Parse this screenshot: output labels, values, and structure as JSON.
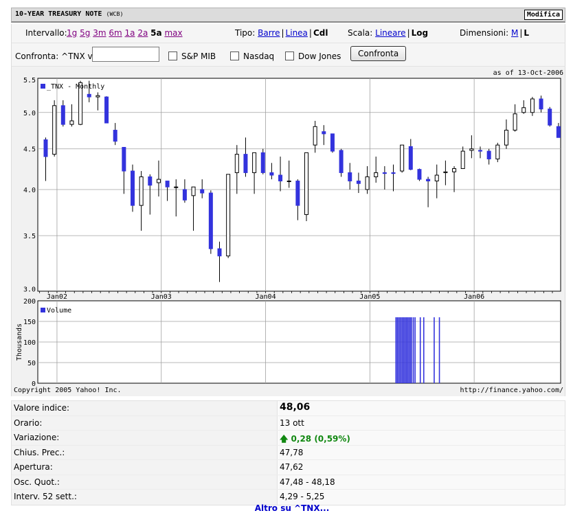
{
  "header": {
    "title": "10-YEAR TREASURY NOTE",
    "exchange": "(WCB)",
    "edit_label": "Modifica"
  },
  "range": {
    "label": "Intervallo:",
    "options": [
      "1g",
      "5g",
      "3m",
      "6m",
      "1a",
      "2a",
      "5a",
      "max"
    ],
    "selected": "5a"
  },
  "type": {
    "label": "Tipo:",
    "options": [
      "Barre",
      "Linea",
      "Cdl"
    ],
    "selected": "Cdl"
  },
  "scale": {
    "label": "Scala:",
    "options": [
      "Lineare",
      "Log"
    ],
    "selected": "Log"
  },
  "size": {
    "label": "Dimensioni:",
    "options": [
      "M",
      "L"
    ],
    "selected": "L"
  },
  "compare": {
    "label": "Confronta: ^TNX vs",
    "input_value": "",
    "checkboxes": [
      "S&P MIB",
      "Nasdaq",
      "Dow Jones"
    ],
    "button_label": "Confronta"
  },
  "colors": {
    "down": "#3333dd",
    "up": "#ffffff",
    "volume": "#3333dd",
    "grid": "#a0a0a0"
  },
  "chart_data": {
    "type": "candlestick",
    "asof": "as of 13-Oct-2006",
    "series_label": "_TNX - Monthly",
    "volume_label": "Volume",
    "volume_axis_label": "Thousands",
    "copyright": "Copyright 2005 Yahoo! Inc.",
    "source": "http://finance.yahoo.com/",
    "price_ticks": [
      "5.5",
      "5.0",
      "4.5",
      "4.0",
      "3.5",
      "3.0"
    ],
    "price_tick_values": [
      5.5,
      5.0,
      4.5,
      4.0,
      3.5,
      3.0
    ],
    "ylim": [
      2.98,
      5.52
    ],
    "scale": "log",
    "volume_ticks": [
      "200",
      "150",
      "100",
      "50",
      "0"
    ],
    "volume_tick_values": [
      200,
      150,
      100,
      50,
      0
    ],
    "volume_ylim": [
      0,
      200
    ],
    "x_ticks": [
      "Jan02",
      "Jan03",
      "Jan04",
      "Jan05",
      "Jan06"
    ],
    "x_tick_index": [
      2,
      14,
      26,
      38,
      50
    ],
    "candles": [
      {
        "o": 4.62,
        "h": 4.65,
        "l": 4.1,
        "c": 4.4
      },
      {
        "o": 4.43,
        "h": 5.18,
        "l": 4.4,
        "c": 5.1
      },
      {
        "o": 5.1,
        "h": 5.18,
        "l": 4.8,
        "c": 4.83
      },
      {
        "o": 4.83,
        "h": 5.12,
        "l": 4.8,
        "c": 4.88
      },
      {
        "o": 4.83,
        "h": 5.48,
        "l": 4.82,
        "c": 5.45
      },
      {
        "o": 5.27,
        "h": 5.48,
        "l": 5.15,
        "c": 5.23
      },
      {
        "o": 5.23,
        "h": 5.3,
        "l": 5.03,
        "c": 5.25
      },
      {
        "o": 5.23,
        "h": 5.24,
        "l": 4.85,
        "c": 4.85
      },
      {
        "o": 4.75,
        "h": 4.85,
        "l": 4.55,
        "c": 4.6
      },
      {
        "o": 4.52,
        "h": 4.52,
        "l": 3.95,
        "c": 4.22
      },
      {
        "o": 4.22,
        "h": 4.3,
        "l": 3.75,
        "c": 3.82
      },
      {
        "o": 3.82,
        "h": 4.22,
        "l": 3.55,
        "c": 4.15
      },
      {
        "o": 4.15,
        "h": 4.18,
        "l": 3.72,
        "c": 4.05
      },
      {
        "o": 4.08,
        "h": 4.35,
        "l": 3.92,
        "c": 4.12
      },
      {
        "o": 4.1,
        "h": 4.1,
        "l": 3.87,
        "c": 4.03
      },
      {
        "o": 4.03,
        "h": 4.12,
        "l": 3.7,
        "c": 4.03
      },
      {
        "o": 4.0,
        "h": 4.12,
        "l": 3.85,
        "c": 3.88
      },
      {
        "o": 3.93,
        "h": 4.03,
        "l": 3.55,
        "c": 4.03
      },
      {
        "o": 4.0,
        "h": 4.12,
        "l": 3.9,
        "c": 3.96
      },
      {
        "o": 3.96,
        "h": 3.99,
        "l": 3.32,
        "c": 3.37
      },
      {
        "o": 3.37,
        "h": 3.44,
        "l": 3.06,
        "c": 3.3
      },
      {
        "o": 3.3,
        "h": 4.18,
        "l": 3.28,
        "c": 4.18
      },
      {
        "o": 4.2,
        "h": 4.55,
        "l": 3.95,
        "c": 4.43
      },
      {
        "o": 4.43,
        "h": 4.65,
        "l": 4.15,
        "c": 4.2
      },
      {
        "o": 4.2,
        "h": 4.45,
        "l": 3.95,
        "c": 4.45
      },
      {
        "o": 4.45,
        "h": 4.5,
        "l": 4.18,
        "c": 4.2
      },
      {
        "o": 4.2,
        "h": 4.32,
        "l": 4.12,
        "c": 4.17
      },
      {
        "o": 4.17,
        "h": 4.4,
        "l": 3.98,
        "c": 4.1
      },
      {
        "o": 4.1,
        "h": 4.35,
        "l": 4.02,
        "c": 4.1
      },
      {
        "o": 4.1,
        "h": 4.12,
        "l": 3.66,
        "c": 3.82
      },
      {
        "o": 3.72,
        "h": 4.45,
        "l": 3.65,
        "c": 4.45
      },
      {
        "o": 4.55,
        "h": 4.88,
        "l": 4.45,
        "c": 4.8
      },
      {
        "o": 4.73,
        "h": 4.82,
        "l": 4.55,
        "c": 4.7
      },
      {
        "o": 4.7,
        "h": 4.7,
        "l": 4.45,
        "c": 4.47
      },
      {
        "o": 4.48,
        "h": 4.5,
        "l": 4.15,
        "c": 4.2
      },
      {
        "o": 4.2,
        "h": 4.32,
        "l": 4.0,
        "c": 4.1
      },
      {
        "o": 4.1,
        "h": 4.2,
        "l": 3.96,
        "c": 4.07
      },
      {
        "o": 4.0,
        "h": 4.28,
        "l": 3.95,
        "c": 4.15
      },
      {
        "o": 4.15,
        "h": 4.4,
        "l": 4.08,
        "c": 4.2
      },
      {
        "o": 4.2,
        "h": 4.28,
        "l": 4.0,
        "c": 4.19
      },
      {
        "o": 4.2,
        "h": 4.3,
        "l": 3.98,
        "c": 4.19
      },
      {
        "o": 4.22,
        "h": 4.55,
        "l": 4.2,
        "c": 4.55
      },
      {
        "o": 4.53,
        "h": 4.63,
        "l": 4.23,
        "c": 4.24
      },
      {
        "o": 4.24,
        "h": 4.25,
        "l": 4.1,
        "c": 4.12
      },
      {
        "o": 4.12,
        "h": 4.15,
        "l": 3.8,
        "c": 4.1
      },
      {
        "o": 4.1,
        "h": 4.3,
        "l": 3.9,
        "c": 4.17
      },
      {
        "o": 4.2,
        "h": 4.35,
        "l": 4.05,
        "c": 4.21
      },
      {
        "o": 4.21,
        "h": 4.28,
        "l": 3.97,
        "c": 4.25
      },
      {
        "o": 4.25,
        "h": 4.53,
        "l": 4.25,
        "c": 4.47
      },
      {
        "o": 4.48,
        "h": 4.68,
        "l": 4.38,
        "c": 4.5
      },
      {
        "o": 4.48,
        "h": 4.53,
        "l": 4.38,
        "c": 4.47
      },
      {
        "o": 4.47,
        "h": 4.5,
        "l": 4.3,
        "c": 4.37
      },
      {
        "o": 4.37,
        "h": 4.58,
        "l": 4.33,
        "c": 4.55
      },
      {
        "o": 4.55,
        "h": 4.9,
        "l": 4.5,
        "c": 4.75
      },
      {
        "o": 4.75,
        "h": 5.12,
        "l": 4.73,
        "c": 4.98
      },
      {
        "o": 5.0,
        "h": 5.18,
        "l": 4.98,
        "c": 5.07
      },
      {
        "o": 5.0,
        "h": 5.23,
        "l": 4.95,
        "c": 5.2
      },
      {
        "o": 5.2,
        "h": 5.25,
        "l": 5.0,
        "c": 5.05
      },
      {
        "o": 5.05,
        "h": 5.08,
        "l": 4.8,
        "c": 4.82
      },
      {
        "o": 4.8,
        "h": 4.85,
        "l": 4.65,
        "c": 4.65
      }
    ],
    "volume_bars": [
      {
        "i": 40.3,
        "v": 160
      },
      {
        "i": 40.45,
        "v": 160
      },
      {
        "i": 40.6,
        "v": 160
      },
      {
        "i": 40.75,
        "v": 160
      },
      {
        "i": 40.9,
        "v": 160
      },
      {
        "i": 41.05,
        "v": 160
      },
      {
        "i": 41.2,
        "v": 160
      },
      {
        "i": 41.35,
        "v": 160
      },
      {
        "i": 41.5,
        "v": 160
      },
      {
        "i": 41.65,
        "v": 160
      },
      {
        "i": 41.8,
        "v": 160
      },
      {
        "i": 41.95,
        "v": 160
      },
      {
        "i": 42.1,
        "v": 160
      },
      {
        "i": 42.3,
        "v": 160
      },
      {
        "i": 42.5,
        "v": 160
      },
      {
        "i": 43.1,
        "v": 160
      },
      {
        "i": 43.5,
        "v": 160
      },
      {
        "i": 44.7,
        "v": 160
      },
      {
        "i": 45.3,
        "v": 160
      }
    ]
  },
  "quote": {
    "rows": [
      {
        "label": "Valore indice:",
        "value": "48,06"
      },
      {
        "label": "Orario:",
        "value": "13 ott"
      },
      {
        "label": "Variazione:",
        "value": "0,28 (0,59%)"
      },
      {
        "label": "Chius. Prec.:",
        "value": "47,78"
      },
      {
        "label": "Apertura:",
        "value": "47,62"
      },
      {
        "label": "Osc. Quot.:",
        "value": "47,48 - 48,18"
      },
      {
        "label": "Interv. 52 sett.:",
        "value": "4,29 - 5,25"
      }
    ]
  },
  "footer": {
    "more_link": "Altro su ^TNX..."
  }
}
